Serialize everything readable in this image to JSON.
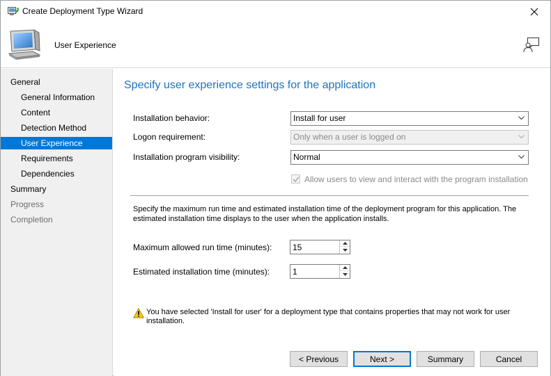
{
  "window": {
    "title": "Create Deployment Type Wizard"
  },
  "header": {
    "title": "User Experience",
    "icons": {
      "app": "computer-icon",
      "help": "help-person-icon"
    }
  },
  "nav": {
    "items": [
      {
        "label": "General",
        "level": 1,
        "state": "normal"
      },
      {
        "label": "General Information",
        "level": 2,
        "state": "normal"
      },
      {
        "label": "Content",
        "level": 2,
        "state": "normal"
      },
      {
        "label": "Detection Method",
        "level": 2,
        "state": "normal"
      },
      {
        "label": "User Experience",
        "level": 2,
        "state": "selected"
      },
      {
        "label": "Requirements",
        "level": 2,
        "state": "normal"
      },
      {
        "label": "Dependencies",
        "level": 2,
        "state": "normal"
      },
      {
        "label": "Summary",
        "level": 1,
        "state": "normal"
      },
      {
        "label": "Progress",
        "level": 1,
        "state": "disabled"
      },
      {
        "label": "Completion",
        "level": 1,
        "state": "disabled"
      }
    ]
  },
  "main": {
    "heading": "Specify user experience settings for the application",
    "installation_behavior": {
      "label": "Installation behavior:",
      "value": "Install for user"
    },
    "logon_requirement": {
      "label": "Logon requirement:",
      "value": "Only when a user is logged on"
    },
    "program_visibility": {
      "label": "Installation program visibility:",
      "value": "Normal"
    },
    "allow_interact": {
      "label": "Allow users to view and interact with the program installation",
      "checked": true,
      "enabled": false
    },
    "description": "Specify the maximum run time and estimated installation time of the deployment program for this application. The estimated installation time displays to the user when the application installs.",
    "max_run_time": {
      "label": "Maximum allowed run time (minutes):",
      "value": "15"
    },
    "estimated_time": {
      "label": "Estimated installation time (minutes):",
      "value": "1"
    },
    "warning": "You have selected 'Install for user' for a deployment type that contains properties that may not work for user installation."
  },
  "buttons": {
    "previous": "< Previous",
    "next": "Next >",
    "summary": "Summary",
    "cancel": "Cancel"
  },
  "colors": {
    "accent": "#0078d7",
    "heading": "#1e73be",
    "nav_background": "#f0f0f0",
    "warning": "#f2c811"
  }
}
